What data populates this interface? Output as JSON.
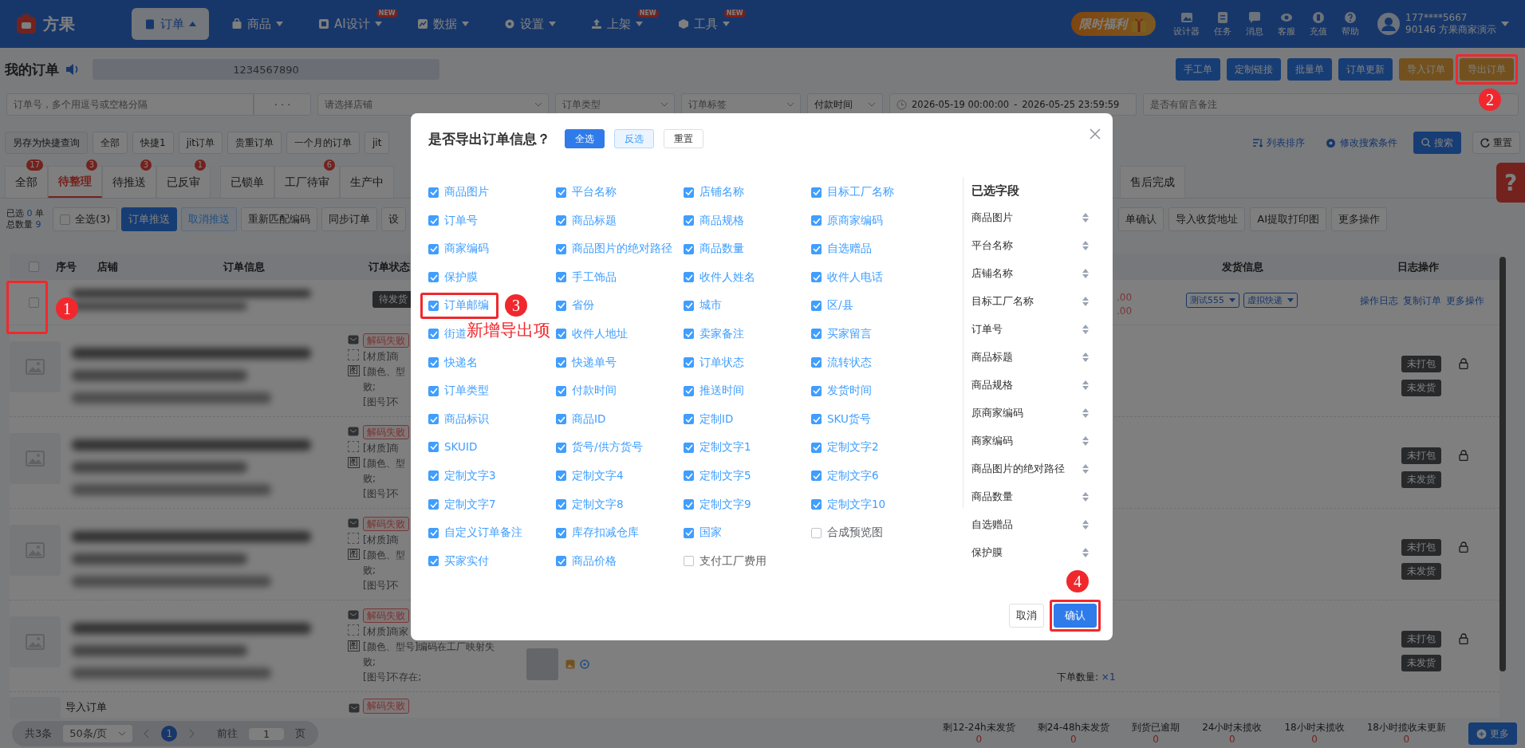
{
  "nav": {
    "logo": "方果",
    "items": [
      {
        "label": "订单",
        "selected": true
      },
      {
        "label": "商品",
        "selected": false
      },
      {
        "label": "AI设计",
        "selected": false,
        "badge": "NEW"
      },
      {
        "label": "数据",
        "selected": false
      },
      {
        "label": "设置",
        "selected": false
      },
      {
        "label": "上架",
        "selected": false,
        "badge": "NEW"
      },
      {
        "label": "工具",
        "selected": false,
        "badge": "NEW"
      }
    ],
    "promo": "限时福利",
    "tools": [
      "设计器",
      "任务",
      "消息",
      "客服",
      "充值",
      "帮助"
    ],
    "user": {
      "phone": "177****5667",
      "account": "90146 方果商家演示"
    }
  },
  "header": {
    "title": "我的订单",
    "notice": "1234567890",
    "buttons": [
      {
        "label": "手工单",
        "kind": "primary"
      },
      {
        "label": "定制链接",
        "kind": "primary"
      },
      {
        "label": "批量单",
        "kind": "primary"
      },
      {
        "label": "订单更新",
        "kind": "primary"
      },
      {
        "label": "导入订单",
        "kind": "warning"
      },
      {
        "label": "导出订单",
        "kind": "warning",
        "callout": "2"
      }
    ]
  },
  "filters": {
    "order_no": {
      "placeholder": "订单号，多个用逗号或空格分隔",
      "more": "· · ·"
    },
    "selects": [
      {
        "placeholder": "请选择店铺"
      },
      {
        "placeholder": "订单类型"
      },
      {
        "placeholder": "订单标签"
      }
    ],
    "time_type": "付款时间",
    "date_start": "2026-05-19 00:00:00",
    "date_sep": "-",
    "date_end": "2026-05-25 23:59:59",
    "remark": {
      "placeholder": "是否有留言备注"
    }
  },
  "quick": {
    "save": "另存为快捷查询",
    "items": [
      "全部",
      "快捷1",
      "jit订单",
      "贵重订单",
      "一个月的订单",
      "jit"
    ],
    "sort": "列表排序",
    "edit": "修改搜索条件",
    "search": "搜索",
    "reset": "重置"
  },
  "tabs": [
    {
      "label": "全部",
      "count": "17",
      "selected": false
    },
    {
      "label": "待整理",
      "count": "3",
      "selected": true
    },
    {
      "label": "待推送",
      "count": "3",
      "selected": false
    },
    {
      "label": "已反审",
      "count": "1",
      "selected": false
    },
    {
      "label": "已锁单",
      "selected": false
    },
    {
      "label": "工厂待审",
      "count": "6",
      "selected": false
    },
    {
      "label": "生产中",
      "selected": false
    },
    {
      "label": "售后完成",
      "selected": false
    }
  ],
  "actions": {
    "selected_label": "已选",
    "selected_count": "0",
    "selected_unit": "单",
    "total_label": "总数量",
    "total_count": "9",
    "select_all": {
      "label": "全选(3)",
      "checked": false
    },
    "left": [
      {
        "label": "订单推送",
        "kind": "primary"
      },
      {
        "label": "取消推送",
        "kind": "light"
      },
      {
        "label": "重新匹配编码",
        "kind": "plain"
      },
      {
        "label": "同步订单",
        "kind": "plain"
      },
      {
        "label": "设",
        "kind": "plain"
      }
    ],
    "right": [
      "单确认",
      "导入收货地址",
      "AI提取打印图",
      "更多操作"
    ]
  },
  "table": {
    "header_checked": false,
    "columns": [
      "序号",
      "店铺",
      "订单信息",
      "订单状态",
      "发货信息",
      "日志操作"
    ],
    "order": {
      "checked": false,
      "callout": "1",
      "status": "待发货",
      "amounts": [
        ".00",
        ".00"
      ],
      "shop_select": "测试555",
      "express_select": "虚拟快递",
      "links": [
        "操作日志",
        "复制订单",
        "更多操作"
      ]
    },
    "items": [
      {
        "image_mark": "图",
        "tag": "解码失败",
        "lines": [
          "[材质]商",
          "[颜色、型",
          "败;",
          "[图号]不"
        ],
        "pack": "未打包",
        "ship": "未发货",
        "locked": true
      },
      {
        "image_mark": "图",
        "tag": "解码失败",
        "lines": [
          "[材质]商",
          "[颜色、型",
          "败;",
          "[图号]不"
        ],
        "pack": "未打包",
        "ship": "未发货",
        "locked": true
      },
      {
        "image_mark": "图",
        "tag": "解码失败",
        "lines": [
          "[材质]商",
          "[颜色、型",
          "败;",
          "[图号]不"
        ],
        "pack": "未打包",
        "ship": "未发货",
        "locked": true
      },
      {
        "image_mark": "图",
        "tag": "解码失败",
        "lines": [
          "[材质]商家",
          "[颜色、型号]编码在工厂映射失",
          "败;",
          "[图号]不存在;"
        ],
        "quantity_label": "下单数量:",
        "quantity": "×1",
        "pack": "未打包",
        "ship": "未发货",
        "locked": true
      }
    ],
    "partial": {
      "title": "导入订单",
      "tag": "解码失败"
    }
  },
  "footer": {
    "total": "共3条",
    "page_size": "50条/页",
    "page": "1",
    "goto": "前往",
    "goto_value": "1",
    "page_unit": "页",
    "stats": [
      {
        "label": "剩12-24h未发货",
        "value": "0"
      },
      {
        "label": "剩24-48h未发货",
        "value": "0"
      },
      {
        "label": "到货已逾期",
        "value": "0"
      },
      {
        "label": "24小时未揽收",
        "value": "0"
      },
      {
        "label": "18小时未揽收",
        "value": "0"
      },
      {
        "label": "18小时揽收未更新",
        "value": "0"
      }
    ],
    "more": "更多"
  },
  "help_tab": "?",
  "modal": {
    "title": "是否导出订单信息？",
    "select_all": "全选",
    "invert": "反选",
    "reset": "重置",
    "fields": [
      {
        "label": "商品图片",
        "checked": true
      },
      {
        "label": "平台名称",
        "checked": true
      },
      {
        "label": "店铺名称",
        "checked": true
      },
      {
        "label": "目标工厂名称",
        "checked": true
      },
      {
        "label": "订单号",
        "checked": true
      },
      {
        "label": "商品标题",
        "checked": true
      },
      {
        "label": "商品规格",
        "checked": true
      },
      {
        "label": "原商家编码",
        "checked": true
      },
      {
        "label": "商家编码",
        "checked": true
      },
      {
        "label": "商品图片的绝对路径",
        "checked": true
      },
      {
        "label": "商品数量",
        "checked": true
      },
      {
        "label": "自选赠品",
        "checked": true
      },
      {
        "label": "保护膜",
        "checked": true
      },
      {
        "label": "手工饰品",
        "checked": true
      },
      {
        "label": "收件人姓名",
        "checked": true
      },
      {
        "label": "收件人电话",
        "checked": true
      },
      {
        "label": "订单邮编",
        "checked": true,
        "callout": "3",
        "note": "新增导出项"
      },
      {
        "label": "省份",
        "checked": true
      },
      {
        "label": "城市",
        "checked": true
      },
      {
        "label": "区/县",
        "checked": true
      },
      {
        "label": "街道",
        "checked": true
      },
      {
        "label": "收件人地址",
        "checked": true
      },
      {
        "label": "卖家备注",
        "checked": true
      },
      {
        "label": "买家留言",
        "checked": true
      },
      {
        "label": "快递名",
        "checked": true
      },
      {
        "label": "快递单号",
        "checked": true
      },
      {
        "label": "订单状态",
        "checked": true
      },
      {
        "label": "流转状态",
        "checked": true
      },
      {
        "label": "订单类型",
        "checked": true
      },
      {
        "label": "付款时间",
        "checked": true
      },
      {
        "label": "推送时间",
        "checked": true
      },
      {
        "label": "发货时间",
        "checked": true
      },
      {
        "label": "商品标识",
        "checked": true
      },
      {
        "label": "商品ID",
        "checked": true
      },
      {
        "label": "定制ID",
        "checked": true
      },
      {
        "label": "SKU货号",
        "checked": true
      },
      {
        "label": "SKUID",
        "checked": true
      },
      {
        "label": "货号/供方货号",
        "checked": true
      },
      {
        "label": "定制文字1",
        "checked": true
      },
      {
        "label": "定制文字2",
        "checked": true
      },
      {
        "label": "定制文字3",
        "checked": true
      },
      {
        "label": "定制文字4",
        "checked": true
      },
      {
        "label": "定制文字5",
        "checked": true
      },
      {
        "label": "定制文字6",
        "checked": true
      },
      {
        "label": "定制文字7",
        "checked": true
      },
      {
        "label": "定制文字8",
        "checked": true
      },
      {
        "label": "定制文字9",
        "checked": true
      },
      {
        "label": "定制文字10",
        "checked": true
      },
      {
        "label": "自定义订单备注",
        "checked": true
      },
      {
        "label": "库存扣减仓库",
        "checked": true
      },
      {
        "label": "国家",
        "checked": true
      },
      {
        "label": "合成预览图",
        "checked": false
      },
      {
        "label": "买家实付",
        "checked": true
      },
      {
        "label": "商品价格",
        "checked": true
      },
      {
        "label": "支付工厂费用",
        "checked": false
      }
    ],
    "selected_title": "已选字段",
    "selected": [
      "商品图片",
      "平台名称",
      "店铺名称",
      "目标工厂名称",
      "订单号",
      "商品标题",
      "商品规格",
      "原商家编码",
      "商家编码",
      "商品图片的绝对路径",
      "商品数量",
      "自选赠品",
      "保护膜"
    ],
    "cancel": "取消",
    "confirm": {
      "label": "确认",
      "callout": "4"
    }
  }
}
